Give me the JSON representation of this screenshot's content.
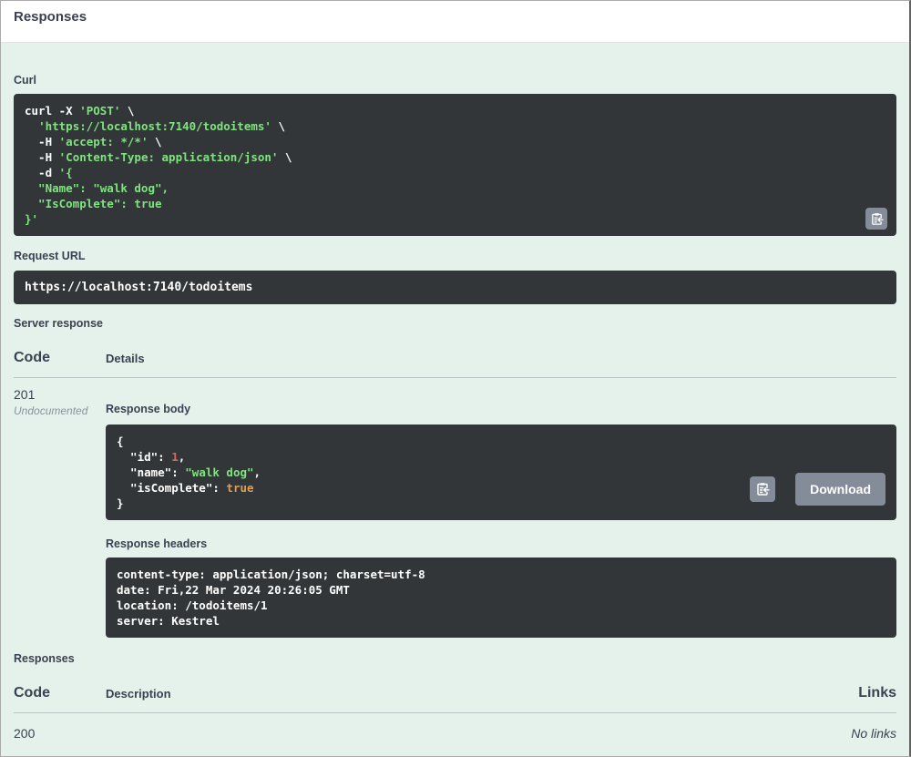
{
  "colors": {
    "page_bg": "#ffffff",
    "panel_bg": "#e5f2eb",
    "code_bg": "#333639",
    "code_plain": "#ffffff",
    "code_string": "#7fe47e",
    "code_number": "#cc6b63",
    "code_boolean": "#e09e50",
    "heading": "#3b4151",
    "muted": "#8a929e",
    "button_bg": "#858c99",
    "divider": "rgba(59,65,81,0.25)",
    "border": "#ababab"
  },
  "header": {
    "title": "Responses"
  },
  "request": {
    "curl_label": "Curl",
    "request_url_label": "Request URL",
    "request_url": "https://localhost:7140/todoitems"
  },
  "server_response": {
    "label": "Server response",
    "code_header": "Code",
    "details_header": "Details",
    "row": {
      "code": "201",
      "code_note": "Undocumented",
      "response_body_label": "Response body",
      "download_button": "Download",
      "response_headers_label": "Response headers"
    }
  },
  "responses": {
    "label": "Responses",
    "code_header": "Code",
    "description_header": "Description",
    "links_header": "Links",
    "rows": [
      {
        "code": "200",
        "description": "",
        "links": "No links"
      }
    ]
  },
  "code_blocks": {
    "curl": [
      [
        {
          "t": "curl -X ",
          "c": "p"
        },
        {
          "t": "'POST'",
          "c": "s"
        },
        {
          "t": " \\",
          "c": "p"
        }
      ],
      [
        {
          "t": "  ",
          "c": "p"
        },
        {
          "t": "'https://localhost:7140/todoitems'",
          "c": "s"
        },
        {
          "t": " \\",
          "c": "p"
        }
      ],
      [
        {
          "t": "  -H ",
          "c": "p"
        },
        {
          "t": "'accept: */*'",
          "c": "s"
        },
        {
          "t": " \\",
          "c": "p"
        }
      ],
      [
        {
          "t": "  -H ",
          "c": "p"
        },
        {
          "t": "'Content-Type: application/json'",
          "c": "s"
        },
        {
          "t": " \\",
          "c": "p"
        }
      ],
      [
        {
          "t": "  -d ",
          "c": "p"
        },
        {
          "t": "'{",
          "c": "s"
        }
      ],
      [
        {
          "t": "  \"Name\": \"walk dog\",",
          "c": "s"
        }
      ],
      [
        {
          "t": "  \"IsComplete\": true",
          "c": "s"
        }
      ],
      [
        {
          "t": "}'",
          "c": "s"
        }
      ]
    ],
    "response_body": [
      [
        {
          "t": "{",
          "c": "p"
        }
      ],
      [
        {
          "t": "  \"id\": ",
          "c": "p"
        },
        {
          "t": "1",
          "c": "n"
        },
        {
          "t": ",",
          "c": "p"
        }
      ],
      [
        {
          "t": "  \"name\": ",
          "c": "p"
        },
        {
          "t": "\"walk dog\"",
          "c": "s"
        },
        {
          "t": ",",
          "c": "p"
        }
      ],
      [
        {
          "t": "  \"isComplete\": ",
          "c": "p"
        },
        {
          "t": "true",
          "c": "b"
        }
      ],
      [
        {
          "t": "}",
          "c": "p"
        }
      ]
    ],
    "response_headers": [
      [
        {
          "t": "content-type: application/json; charset=utf-8",
          "c": "p"
        }
      ],
      [
        {
          "t": "date: Fri,22 Mar 2024 20:26:05 GMT",
          "c": "p"
        }
      ],
      [
        {
          "t": "location: /todoitems/1",
          "c": "p"
        }
      ],
      [
        {
          "t": "server: Kestrel",
          "c": "p"
        }
      ]
    ]
  },
  "icons": {
    "copy": "clipboard-copy-icon"
  }
}
